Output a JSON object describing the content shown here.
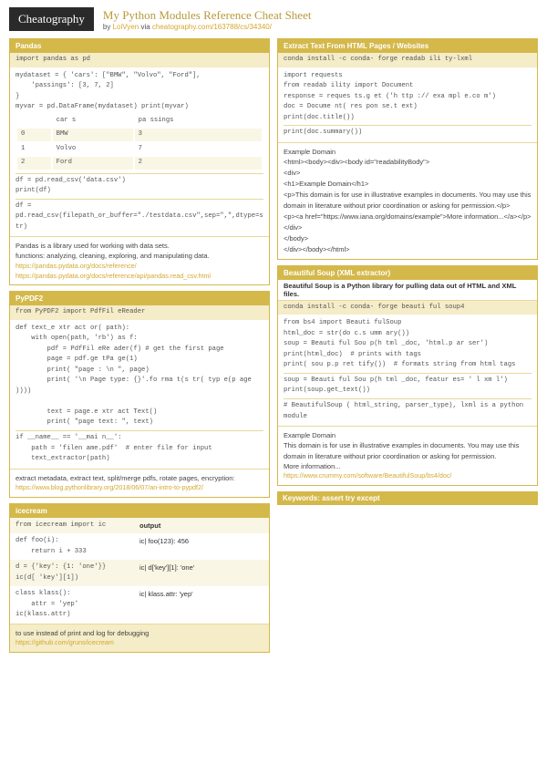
{
  "header": {
    "logo": "Cheatography",
    "title": "My Python Modules Reference Cheat Sheet",
    "by": "by ",
    "author": "LoiVyen",
    "via": " via ",
    "url": "cheatography.com/163788/cs/34340/"
  },
  "left": {
    "pandas": {
      "title": "Pandas",
      "import": "import pandas as pd",
      "code1": "mydataset = { 'cars': [\"BMW\", \"Volvo\", \"Ford\"],\n    'passings': [3, 7, 2]\n}\nmyvar = pd.DataFrame(mydataset) print(myvar)",
      "theaders": [
        "",
        "car s",
        "pa ssings"
      ],
      "rows": [
        [
          "0",
          "BMW",
          "3"
        ],
        [
          "1",
          "Volvo",
          "7"
        ],
        [
          "2",
          "Ford",
          "2"
        ]
      ],
      "code2": "df = pd.read_csv('data.csv')\nprint(df)",
      "code3": "df = pd.read_csv(filepath_or_buffer=\"./testdata.csv\",sep=\",\",dtype=str)",
      "desc": "Pandas is a library used for working with data sets.\nfunctions: analyzing, cleaning, exploring, and manipulating data.",
      "link1": "https://pandas.pydata.org/docs/reference/",
      "link2": "https://pandas.pydata.org/docs/reference/api/pandas.read_csv.html"
    },
    "pypdf2": {
      "title": "PyPDF2",
      "import": "from PyPDF2 import PdfFil eReader",
      "code1": "def text_e xtr act or( path):\n    with open(path, 'rb') as f:\n        pdf = PdfFil eRe ader(f) # get the first page\n        page = pdf.ge tPa ge(1)\n        print( \"page : \\n \", page)\n        print( '\\n Page type: {}'.fo rma t(s tr( typ e(p age ))))\n\n        text = page.e xtr act Text()\n        print( \"page text: \", text)",
      "code2": "if __name__ == '__mai n__':\n    path = 'filen ame.pdf'  # enter file for input\n    text_extractor(path)",
      "desc": "extract metadata, extract text, split/merge pdfs, rotate pages, encryption:",
      "link": "https://www.blog.pythonlibrary.org/2018/06/07/an-intro-to-pypdf2/"
    },
    "icecream": {
      "title": "icecream",
      "rows": [
        {
          "left": "from icecream import ic",
          "right": "output"
        },
        {
          "left": "def foo(i):\n    return i + 333",
          "right": "ic| foo(123): 456"
        },
        {
          "left": "d = {'key': {1: 'one'}}\nic(d[ 'key'][1])",
          "right": "ic| d['key'][1]: 'one'"
        },
        {
          "left": "class klass():\n    attr = 'yep'\nic(klass.attr)",
          "right": "ic| klass.attr: 'yep'"
        }
      ],
      "desc": "to use instead of print and log for debugging",
      "link": "https://github.com/gruns/icecream"
    }
  },
  "right": {
    "extract": {
      "title": "Extract Text From HTML Pages / Websites",
      "code1": "conda install -c conda- forge readab ili ty-lxml",
      "code2": "import requests\nfrom readab ility import Document\nresponse = reques ts.g et ('h ttp :// exa mpl e.co m')\ndoc = Docume nt( res pon se.t ext)\nprint(doc.title())",
      "code3": "print(doc.summary())",
      "subtitle": "Example Domain",
      "html": "<html><body><div><body id=\"readabilityBody\">\n<div>\n<h1>Example Domain</h1>\n<p>This domain is for use in illustrative examples in documents. You may use this\ndomain in literature without prior coordination or asking for permission.</p>\n<p><a href=\"https://www.iana.org/domains/example\">More information...</a></p>\n</div>\n</body>\n</div></body></html>"
    },
    "bs4": {
      "title": "Beautiful Soup (XML extractor)",
      "desc1": "Beautiful Soup is a Python library for pulling data out of HTML and XML files.",
      "code1": "conda install -c conda- forge beauti ful soup4",
      "code2": "from bs4 import Beauti fulSoup\nhtml_doc = str(do c.s umm ary())\nsoup = Beauti ful Sou p(h tml _doc, 'html.p ar ser')\nprint(html_doc)  # prints with tags\nprint( sou p.p ret tify())  # formats string from html tags",
      "code3": "soup = Beauti ful Sou p(h tml _doc, featur es= ' l xm l')\nprint(soup.get_text())",
      "note": "# BeautifulSoup ( html_string, parser_type), lxml is a python module",
      "subtitle": "Example Domain",
      "example": "This domain is for use in illustrative examples in documents. You may use this\ndomain in literature without prior coordination or asking for permission.\nMore information...",
      "link": "https://www.crummy.com/software/BeautifulSoup/bs4/doc/"
    },
    "keywords": "Keywords: assert try except"
  }
}
